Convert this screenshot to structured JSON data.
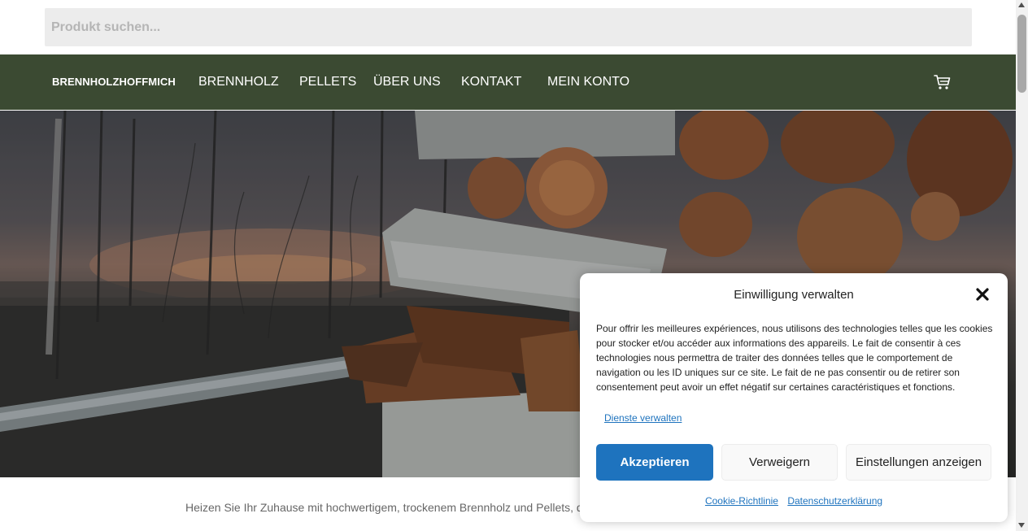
{
  "search": {
    "placeholder": "Produkt suchen..."
  },
  "nav": {
    "brand": "BRENNHOLZHOFFMICH",
    "items": [
      "BRENNHOLZ",
      "PELLETS",
      "ÜBER UNS",
      "KONTAKT",
      "MEIN KONTO"
    ],
    "cart_icon": "cart-icon",
    "background": "#3b4a32"
  },
  "hero": {
    "image": "firewood-stack-photo"
  },
  "intro_text": "Heizen Sie Ihr Zuhause mit hochwertigem, trockenem Brennholz und Pellets, di",
  "consent": {
    "title": "Einwilligung verwalten",
    "close_icon": "close-icon",
    "body": "Pour offrir les meilleures expériences, nous utilisons des technologies telles que les cookies pour stocker et/ou accéder aux informations des appareils. Le fait de consentir à ces technologies nous permettra de traiter des données telles que le comportement de navigation ou les ID uniques sur ce site. Le fait de ne pas consentir ou de retirer son consentement peut avoir un effet négatif sur certaines caractéristiques et fonctions.",
    "manage_link": "Dienste verwalten",
    "accept": "Akzeptieren",
    "deny": "Verweigern",
    "preferences": "Einstellungen anzeigen",
    "cookie_policy": "Cookie-Richtlinie",
    "privacy_policy": "Datenschutzerklärung",
    "accent": "#1e73be"
  }
}
